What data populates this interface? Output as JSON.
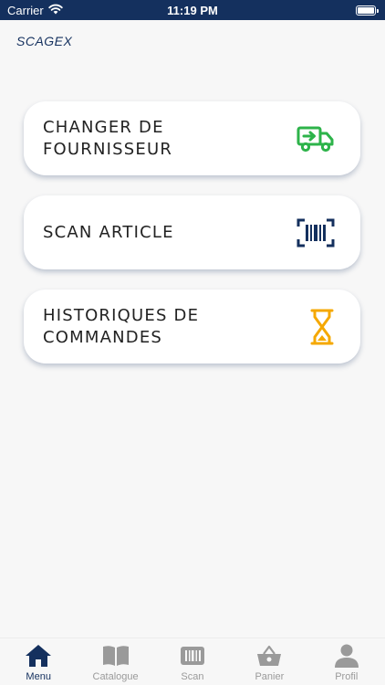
{
  "status_bar": {
    "carrier": "Carrier",
    "time": "11:19 PM"
  },
  "brand": "SCAGEX",
  "menu": {
    "items": [
      {
        "label": "CHANGER DE\nFOURNISSEUR",
        "icon": "delivery-truck-icon",
        "color": "#2db34a"
      },
      {
        "label": "SCAN ARTICLE",
        "icon": "barcode-scan-icon",
        "color": "#14305e"
      },
      {
        "label": "HISTORIQUES DE\nCOMMANDES",
        "icon": "hourglass-icon",
        "color": "#f5a800"
      }
    ]
  },
  "tab_bar": {
    "tabs": [
      {
        "label": "Menu",
        "icon": "home-icon",
        "active": true
      },
      {
        "label": "Catalogue",
        "icon": "book-icon",
        "active": false
      },
      {
        "label": "Scan",
        "icon": "barcode-icon",
        "active": false
      },
      {
        "label": "Panier",
        "icon": "basket-icon",
        "active": false
      },
      {
        "label": "Profil",
        "icon": "user-icon",
        "active": false
      }
    ]
  },
  "colors": {
    "primary": "#14305e",
    "inactive": "#9a9a9a"
  }
}
